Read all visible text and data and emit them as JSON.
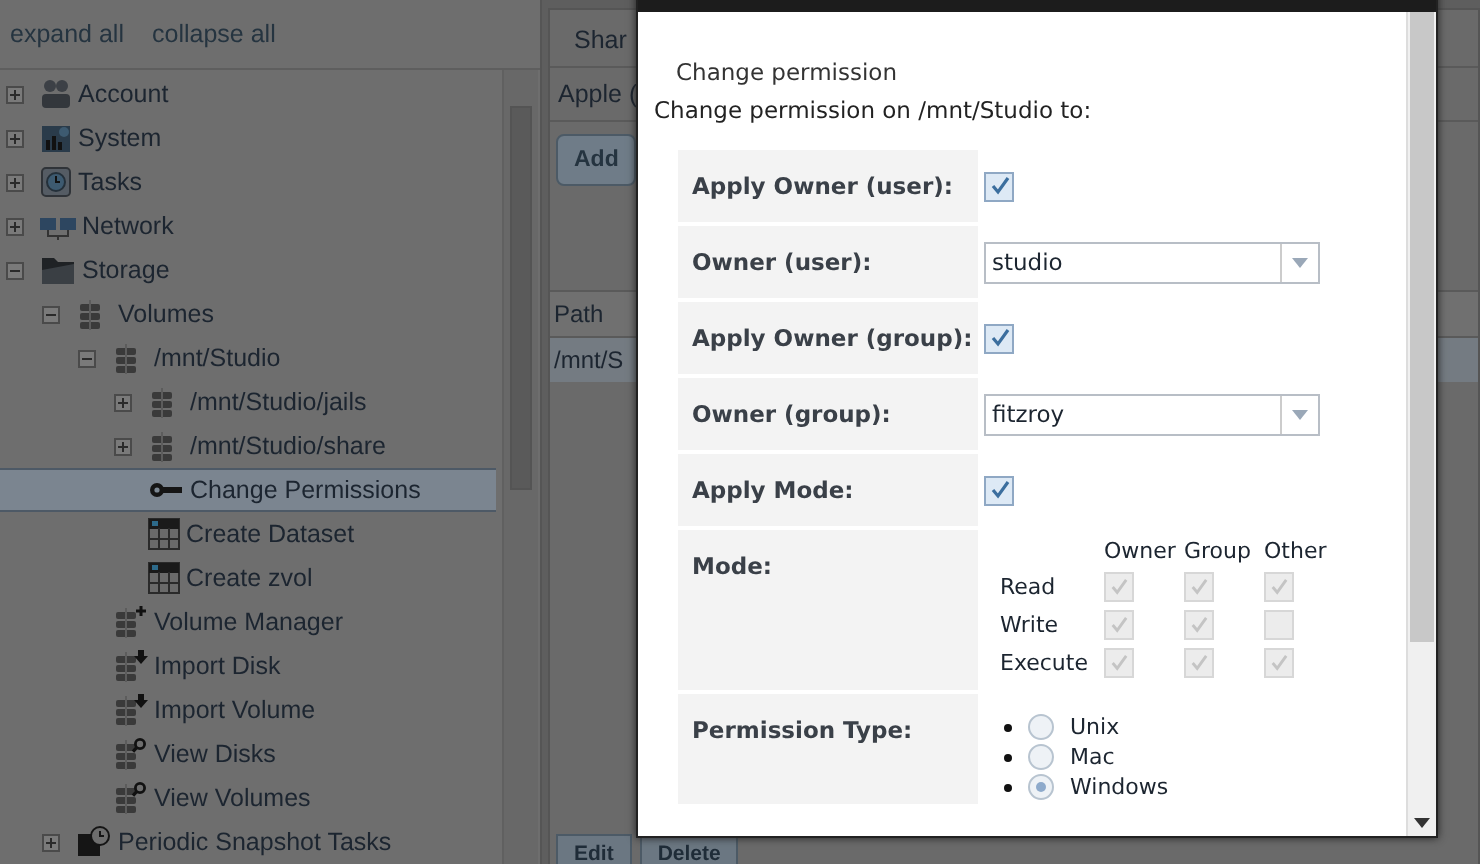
{
  "sidebar": {
    "links": [
      "expand all",
      "collapse all"
    ],
    "tree": [
      {
        "label": "Account",
        "kind": "users",
        "expanded": false,
        "selected": false
      },
      {
        "label": "System",
        "kind": "chart",
        "expanded": false,
        "selected": false
      },
      {
        "label": "Tasks",
        "kind": "clock",
        "expanded": false,
        "selected": false
      },
      {
        "label": "Network",
        "kind": "network",
        "expanded": false,
        "selected": false
      },
      {
        "label": "Storage",
        "kind": "folder",
        "expanded": true,
        "selected": false,
        "children": [
          {
            "label": "Volumes",
            "kind": "disks",
            "expanded": true,
            "selected": false,
            "children": [
              {
                "label": "/mnt/Studio",
                "kind": "disks",
                "expanded": true,
                "selected": false,
                "children": [
                  {
                    "label": "/mnt/Studio/jails",
                    "kind": "disks",
                    "expanded": false,
                    "selected": false
                  },
                  {
                    "label": "/mnt/Studio/share",
                    "kind": "disks",
                    "expanded": false,
                    "selected": false
                  },
                  {
                    "label": "Change Permissions",
                    "kind": "key",
                    "selected": true
                  },
                  {
                    "label": "Create Dataset",
                    "kind": "table",
                    "selected": false
                  },
                  {
                    "label": "Create zvol",
                    "kind": "table",
                    "selected": false
                  }
                ]
              },
              {
                "label": "Volume Manager",
                "kind": "disks-plus",
                "selected": false
              },
              {
                "label": "Import Disk",
                "kind": "disks-arrow",
                "selected": false
              },
              {
                "label": "Import Volume",
                "kind": "disks-arrow",
                "selected": false
              },
              {
                "label": "View Disks",
                "kind": "disks-search",
                "selected": false
              },
              {
                "label": "View Volumes",
                "kind": "disks-search",
                "selected": false
              }
            ]
          },
          {
            "label": "Periodic Snapshot Tasks",
            "kind": "snapshot",
            "expanded": false,
            "selected": false
          }
        ]
      }
    ]
  },
  "main": {
    "tab": "Shar",
    "subtab": "Apple (",
    "add_button": "Add",
    "table": {
      "columns": [
        "Path"
      ],
      "rows": [
        [
          "/mnt/S"
        ]
      ]
    },
    "buttons": [
      "Edit",
      "Delete"
    ]
  },
  "dialog": {
    "heading": "Change permission",
    "intro": "Change permission on /mnt/Studio to:",
    "rows": [
      {
        "kind": "checkbox",
        "label": "Apply Owner (user):",
        "checked": true
      },
      {
        "kind": "select",
        "label": "Owner (user):",
        "value": "studio"
      },
      {
        "kind": "checkbox",
        "label": "Apply Owner (group):",
        "checked": true
      },
      {
        "kind": "select",
        "label": "Owner (group):",
        "value": "fitzroy"
      },
      {
        "kind": "checkbox",
        "label": "Apply Mode:",
        "checked": true
      },
      {
        "kind": "mode",
        "label": "Mode:",
        "columns": [
          "Owner",
          "Group",
          "Other"
        ],
        "rows": [
          {
            "label": "Read",
            "checks": [
              {
                "checked": true,
                "disabled": true
              },
              {
                "checked": true,
                "disabled": true
              },
              {
                "checked": true,
                "disabled": true
              }
            ]
          },
          {
            "label": "Write",
            "checks": [
              {
                "checked": true,
                "disabled": true
              },
              {
                "checked": true,
                "disabled": true
              },
              {
                "checked": false,
                "disabled": true
              }
            ]
          },
          {
            "label": "Execute",
            "checks": [
              {
                "checked": true,
                "disabled": true
              },
              {
                "checked": true,
                "disabled": true
              },
              {
                "checked": true,
                "disabled": true
              }
            ]
          }
        ]
      },
      {
        "kind": "radio",
        "label": "Permission Type:",
        "options": [
          {
            "label": "Unix",
            "selected": false
          },
          {
            "label": "Mac",
            "selected": false
          },
          {
            "label": "Windows",
            "selected": true
          }
        ]
      }
    ]
  }
}
